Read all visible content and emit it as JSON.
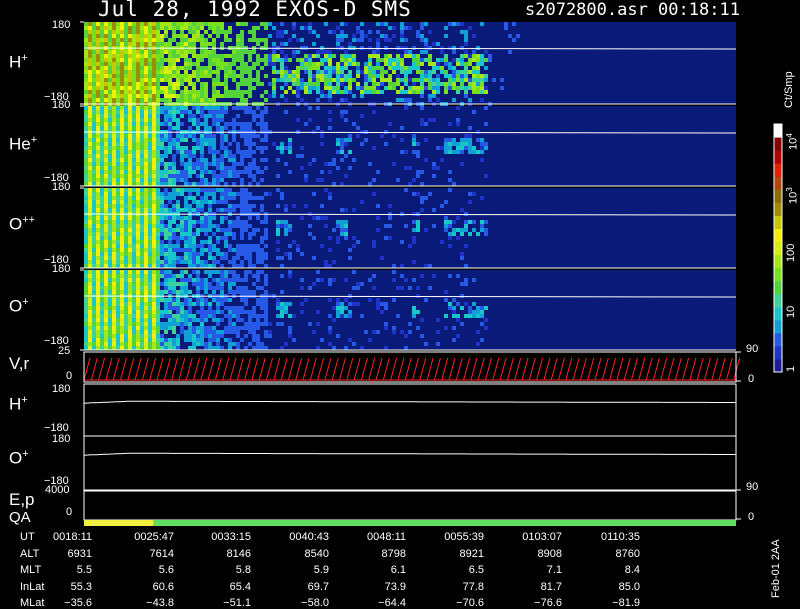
{
  "header": {
    "title": "Jul 28, 1992    EXOS-D SMS",
    "file_time": "s2072800.asr  00:18:11"
  },
  "side_date": "Feb-01 2AA",
  "colorbar": {
    "unit": "Ct/Smp",
    "tick_labels": [
      "1",
      "10",
      "100",
      "10",
      "10"
    ],
    "tick_exponents": [
      "",
      "",
      "",
      "3",
      "4"
    ],
    "colors": [
      "#1a1a9a",
      "#1e33c8",
      "#2659e6",
      "#10a0d8",
      "#18c8c8",
      "#3cd29a",
      "#52d23c",
      "#78e01c",
      "#a6e614",
      "#d8f00c",
      "#f0f000",
      "#c8c800",
      "#a08c00",
      "#8c6e00",
      "#b4460a",
      "#e61e00",
      "#b40000",
      "#8c0000",
      "#ffffff"
    ]
  },
  "chart_data": {
    "type": "heatmap",
    "time_axis": [
      "0018:11",
      "0025:47",
      "0033:15",
      "0040:43",
      "0048:11",
      "0055:39",
      "0103:07",
      "0110:35"
    ],
    "spectrogram_panels": [
      {
        "name": "H",
        "charge": "+",
        "ylim": [
          -180,
          180
        ],
        "tick_top": "180",
        "tick_bottom": "−180"
      },
      {
        "name": "He",
        "charge": "+",
        "ylim": [
          -180,
          180
        ],
        "tick_top": "180",
        "tick_bottom": "−180"
      },
      {
        "name": "O",
        "charge": "++",
        "ylim": [
          -180,
          180
        ],
        "tick_top": "180",
        "tick_bottom": "−180"
      },
      {
        "name": "O",
        "charge": "+",
        "ylim": [
          -180,
          180
        ],
        "tick_top": "180",
        "tick_bottom": "−180"
      }
    ],
    "vr_panel": {
      "label": "V,r",
      "left_ticks": [
        "25",
        "0"
      ],
      "right_ticks": [
        "90",
        "0"
      ],
      "color": "#ff2020"
    },
    "line_panels": [
      {
        "name": "H",
        "charge": "+",
        "tick_top": "180",
        "tick_bottom": "−180"
      },
      {
        "name": "O",
        "charge": "+",
        "tick_top": "180",
        "tick_bottom": "−180"
      }
    ],
    "ep_panel": {
      "label": "E,p",
      "left_ticks": [
        "4000",
        "0"
      ],
      "right_ticks": [
        "90",
        "0"
      ]
    },
    "qa_panel": {
      "label": "QA",
      "segments": [
        {
          "from": 0.0,
          "to": 0.107,
          "color": "#f0f040"
        },
        {
          "from": 0.107,
          "to": 1.0,
          "color": "#60e060"
        }
      ]
    }
  },
  "orbit": {
    "rows": [
      {
        "label": "UT",
        "values": [
          "0018:11",
          "0025:47",
          "0033:15",
          "0040:43",
          "0048:11",
          "0055:39",
          "0103:07",
          "0110:35"
        ]
      },
      {
        "label": "ALT",
        "values": [
          "6931",
          "7614",
          "8146",
          "8540",
          "8798",
          "8921",
          "8908",
          "8760"
        ]
      },
      {
        "label": "MLT",
        "values": [
          "5.5",
          "5.6",
          "5.8",
          "5.9",
          "6.1",
          "6.5",
          "7.1",
          "8.4"
        ]
      },
      {
        "label": "InLat",
        "values": [
          "55.3",
          "60.6",
          "65.4",
          "69.7",
          "73.9",
          "77.8",
          "81.7",
          "85.0"
        ]
      },
      {
        "label": "MLat",
        "values": [
          "−35.6",
          "−43.8",
          "−51.1",
          "−58.0",
          "−64.4",
          "−70.6",
          "−76.6",
          "−81.9"
        ]
      }
    ]
  }
}
